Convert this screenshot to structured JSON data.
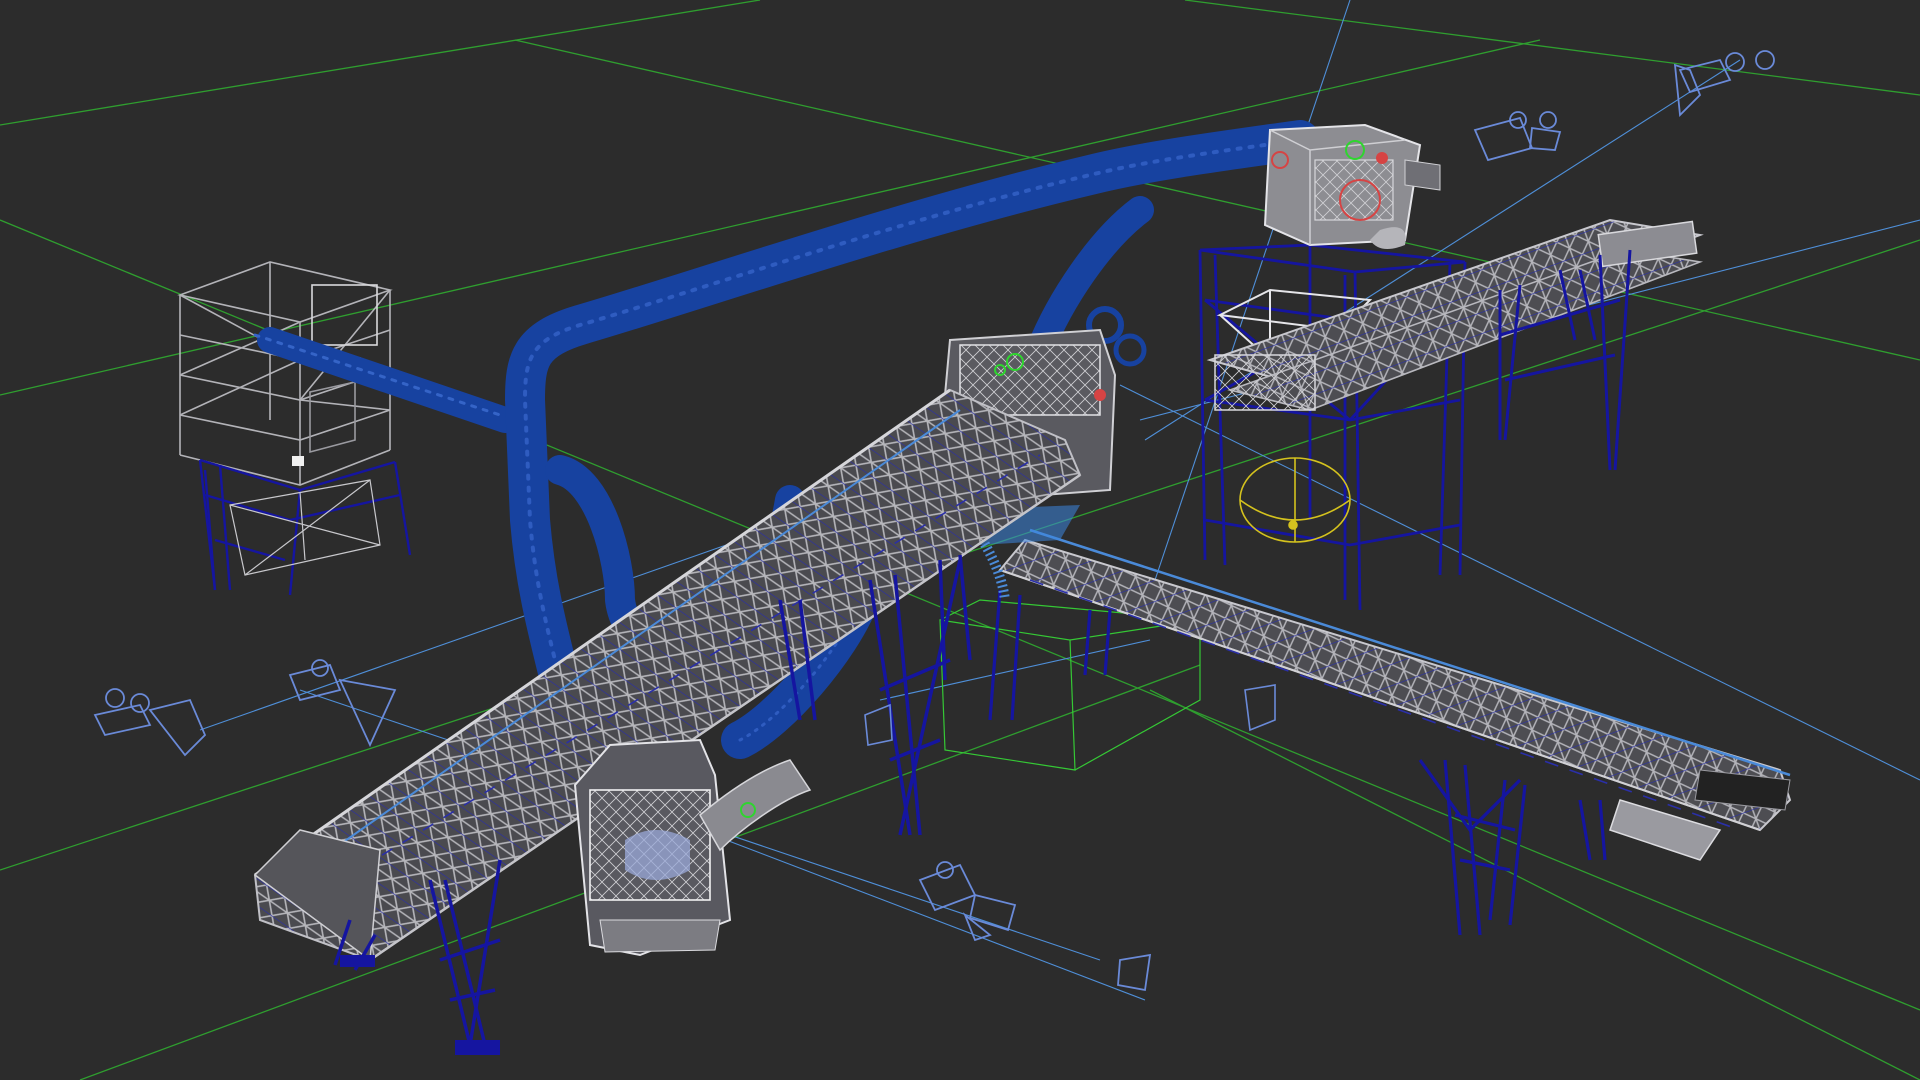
{
  "viewport": {
    "view": "perspective",
    "render_mode": "wireframe",
    "background_color": "#2c2c2c",
    "grid_color": "#2f9e2f",
    "frame_color": "#12148f",
    "duct_color": "#123b9a",
    "mesh_color": "#a9a9ad",
    "camera_color": "#6a8ad8",
    "selection_color": "#d4c21e"
  },
  "scene_objects": [
    {
      "name": "filter-tower"
    },
    {
      "name": "duct-system"
    },
    {
      "name": "main-inclined-conveyor"
    },
    {
      "name": "transfer-hopper"
    },
    {
      "name": "cross-conveyor"
    },
    {
      "name": "crusher-unit"
    },
    {
      "name": "crusher-support-tower"
    },
    {
      "name": "right-feed-conveyor"
    },
    {
      "name": "fan-unit"
    }
  ],
  "cameras": [
    {
      "name": "camera-top-right-far"
    },
    {
      "name": "camera-top-right-near"
    },
    {
      "name": "camera-left-far"
    },
    {
      "name": "camera-left-near"
    },
    {
      "name": "camera-bottom-center"
    },
    {
      "name": "camera-bottom-target"
    }
  ]
}
